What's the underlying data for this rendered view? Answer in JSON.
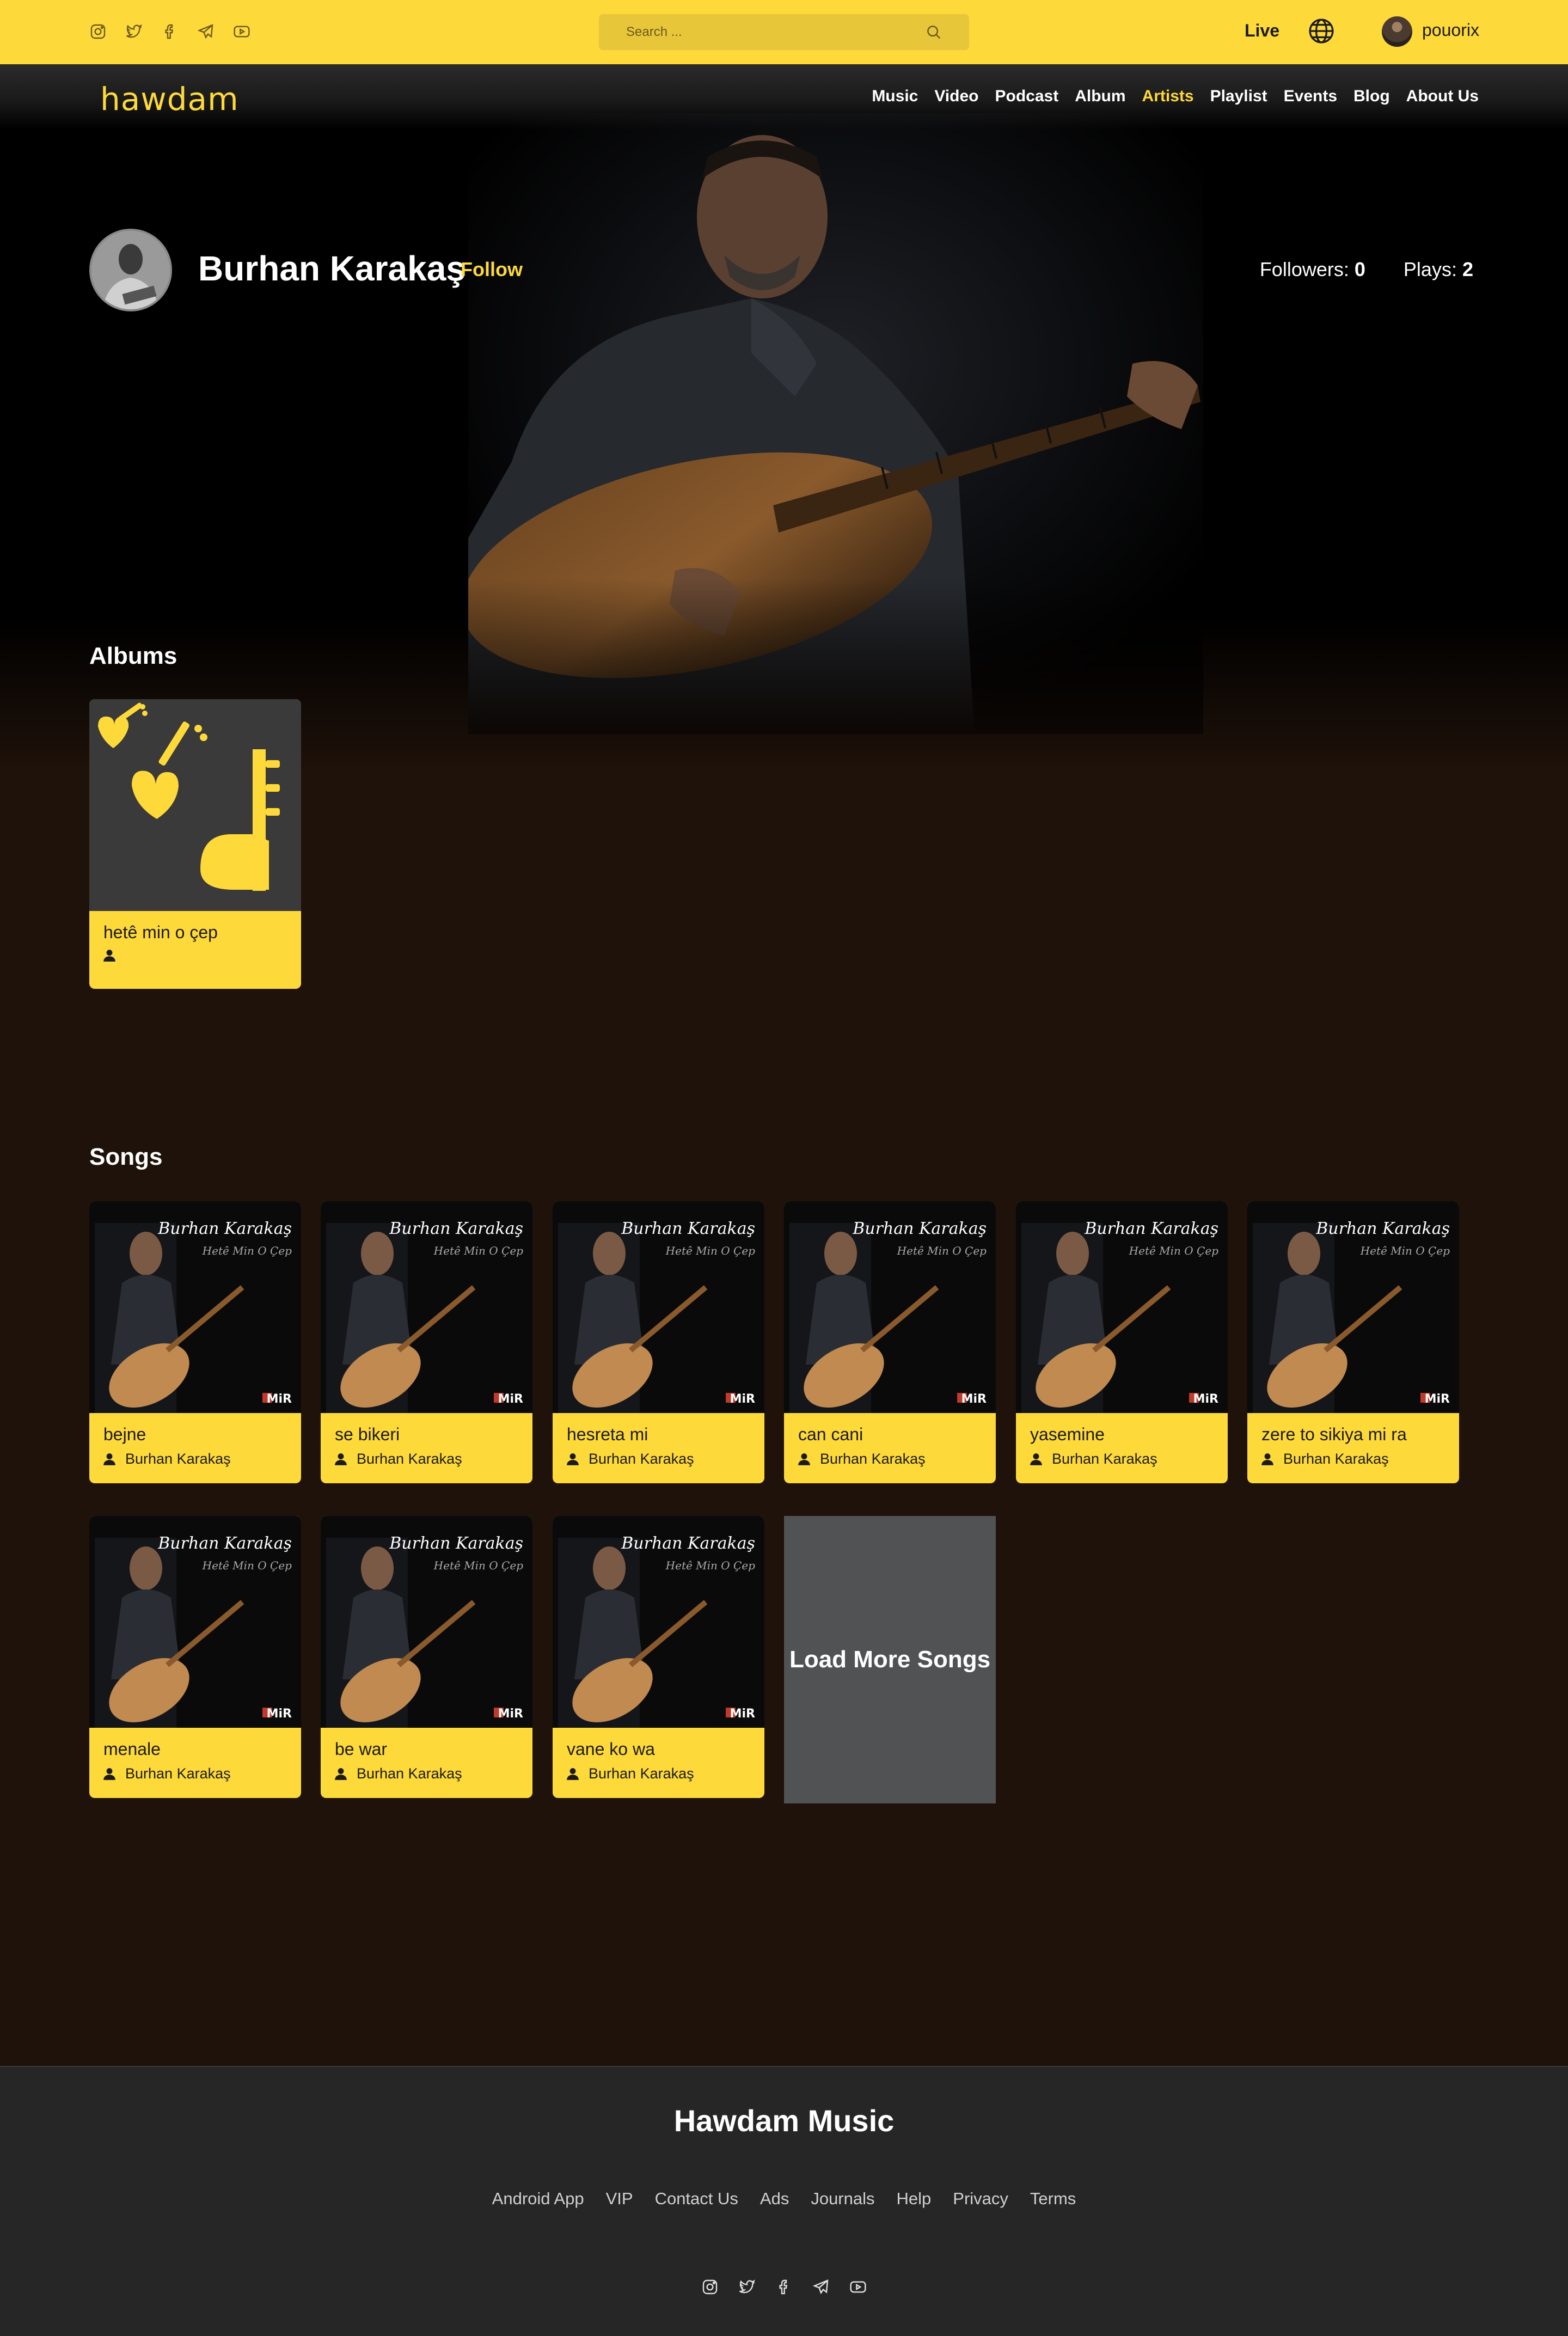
{
  "topbar": {
    "social_icons": [
      "instagram-icon",
      "twitter-icon",
      "facebook-icon",
      "telegram-icon",
      "youtube-icon"
    ],
    "search_placeholder": "Search ...",
    "live_label": "Live",
    "username": "pouorix"
  },
  "brand": {
    "logo_text": "hawdam",
    "accent_color": "#fed93a"
  },
  "nav": {
    "items": [
      {
        "label": "Music"
      },
      {
        "label": "Video"
      },
      {
        "label": "Podcast"
      },
      {
        "label": "Album"
      },
      {
        "label": "Artists",
        "active": true
      },
      {
        "label": "Playlist"
      },
      {
        "label": "Events"
      },
      {
        "label": "Blog"
      },
      {
        "label": "About Us"
      }
    ]
  },
  "artist": {
    "name": "Burhan Karakaş",
    "follow_label": "Follow",
    "followers_label": "Followers:",
    "followers_value": "0",
    "plays_label": "Plays:",
    "plays_value": "2"
  },
  "albums": {
    "title": "Albums",
    "items": [
      {
        "title": "hetê min o çep",
        "artist": ""
      }
    ]
  },
  "songs": {
    "title": "Songs",
    "cover_text": {
      "artist": "Burhan Karakaş",
      "album": "Hetê Min O Çep",
      "label": "MiR"
    },
    "items": [
      {
        "title": "bejne",
        "artist": "Burhan Karakaş"
      },
      {
        "title": "se bikeri",
        "artist": "Burhan Karakaş"
      },
      {
        "title": "hesreta mi",
        "artist": "Burhan Karakaş"
      },
      {
        "title": "can cani",
        "artist": "Burhan Karakaş"
      },
      {
        "title": "yasemine",
        "artist": "Burhan Karakaş"
      },
      {
        "title": "zere to sikiya mi ra",
        "artist": "Burhan Karakaş"
      },
      {
        "title": "menale",
        "artist": "Burhan Karakaş"
      },
      {
        "title": "be war",
        "artist": "Burhan Karakaş"
      },
      {
        "title": "vane ko wa",
        "artist": "Burhan Karakaş"
      }
    ],
    "load_more_label": "Load More Songs"
  },
  "footer": {
    "title": "Hawdam Music",
    "links": [
      "Android App",
      "VIP",
      "Contact Us",
      "Ads",
      "Journals",
      "Help",
      "Privacy",
      "Terms"
    ]
  }
}
